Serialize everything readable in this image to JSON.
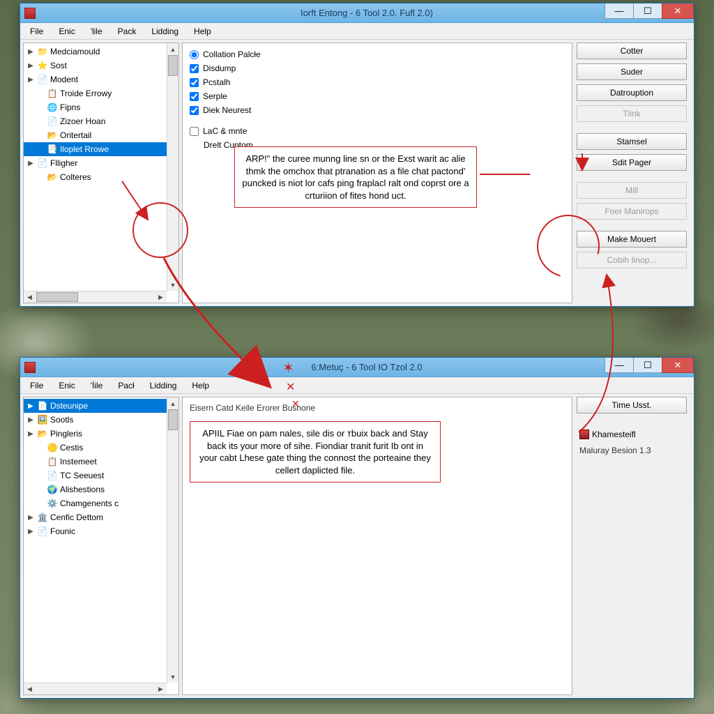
{
  "window1": {
    "title": "Iorft Entong - 6 Tool 2.0. Fufl 2.0)",
    "menus": [
      "File",
      "Enic",
      "'lile",
      "Pack",
      "Lidding",
      "Help"
    ],
    "tree": [
      {
        "exp": "▶",
        "icon": "📁",
        "label": "Medciamould",
        "sel": false,
        "indent": 0
      },
      {
        "exp": "▶",
        "icon": "⭐",
        "label": "Sost",
        "sel": false,
        "indent": 0
      },
      {
        "exp": "▶",
        "icon": "📄",
        "label": "Modent",
        "sel": false,
        "indent": 0
      },
      {
        "exp": "",
        "icon": "📋",
        "label": "Troide Errowy",
        "sel": false,
        "indent": 1
      },
      {
        "exp": "",
        "icon": "🌐",
        "label": "Fipns",
        "sel": false,
        "indent": 1
      },
      {
        "exp": "",
        "icon": "📄",
        "label": "Zizoer Hoan",
        "sel": false,
        "indent": 1
      },
      {
        "exp": "",
        "icon": "📂",
        "label": "Oritertail",
        "sel": false,
        "indent": 1
      },
      {
        "exp": "",
        "icon": "📑",
        "label": "Iloplet Rrowe",
        "sel": true,
        "indent": 1
      },
      {
        "exp": "▶",
        "icon": "📄",
        "label": "Flligher",
        "sel": false,
        "indent": 0
      },
      {
        "exp": "",
        "icon": "📂",
        "label": "Colteres",
        "sel": false,
        "indent": 1
      }
    ],
    "options": [
      {
        "type": "radio",
        "checked": true,
        "label": "Collation Palcłe"
      },
      {
        "type": "check",
        "checked": true,
        "label": "Disdump"
      },
      {
        "type": "check",
        "checked": true,
        "label": "Pcstalh"
      },
      {
        "type": "check",
        "checked": true,
        "label": "Serple"
      },
      {
        "type": "check",
        "checked": true,
        "label": "Diek Neurest"
      },
      {
        "type": "check",
        "checked": false,
        "label": "LaC & mnte"
      },
      {
        "type": "text",
        "label": "Drelt Cuptom"
      }
    ],
    "side_buttons": [
      {
        "label": "Cotter",
        "disabled": false
      },
      {
        "label": "Suder",
        "disabled": false
      },
      {
        "label": "Datrouption",
        "disabled": false
      },
      {
        "label": "Tlink",
        "disabled": true
      },
      {
        "label": "Stamsel",
        "disabled": false
      },
      {
        "label": "Sdit Pager",
        "disabled": false
      },
      {
        "label": "Mill",
        "disabled": true
      },
      {
        "label": "Foer Manirops",
        "disabled": true
      },
      {
        "label": "Make Mouert",
        "disabled": false
      },
      {
        "label": "Cobih Iinop...",
        "disabled": true
      }
    ]
  },
  "window2": {
    "title": "6:Metuç - 6 Tool IO Tzol 2.0",
    "menus": [
      "File",
      "Enic",
      "'İile",
      "Pacł",
      "Lidding",
      "Help"
    ],
    "tree": [
      {
        "exp": "▶",
        "icon": "📄",
        "label": "Dsteunipe",
        "sel": true,
        "indent": 0
      },
      {
        "exp": "▶",
        "icon": "🖼️",
        "label": "Sootls",
        "sel": false,
        "indent": 0
      },
      {
        "exp": "▶",
        "icon": "📂",
        "label": "Pingleris",
        "sel": false,
        "indent": 0
      },
      {
        "exp": "",
        "icon": "🟡",
        "label": "Cestis",
        "sel": false,
        "indent": 1
      },
      {
        "exp": "",
        "icon": "📋",
        "label": "Instemeet",
        "sel": false,
        "indent": 1
      },
      {
        "exp": "",
        "icon": "📄",
        "label": "TC Seeuest",
        "sel": false,
        "indent": 1
      },
      {
        "exp": "",
        "icon": "🌍",
        "label": "Alishestions",
        "sel": false,
        "indent": 1
      },
      {
        "exp": "",
        "icon": "⚙️",
        "label": "Chamgenents c",
        "sel": false,
        "indent": 1
      },
      {
        "exp": "▶",
        "icon": "🏛️",
        "label": "Cenfic Dettom",
        "sel": false,
        "indent": 0
      },
      {
        "exp": "▶",
        "icon": "📄",
        "label": "Founic",
        "sel": false,
        "indent": 0
      }
    ],
    "mid_heading": "Eisern Catd Kelle Erorer Bushone",
    "side_button": "Time Usst.",
    "side_item_label": "Khamesteifl",
    "side_static": "Maluray Besion 1.3"
  },
  "callout1": "ARP!\" the curee munng line sn or the Exst warit ac alie thmk the omchox that ptranation as a file chat pactond' puncked is niot lor cafs ping fraplacl ralt ond coprst ore a crturiion of fites hond uct.",
  "callout2": "APIIL Fiae on pam nales, sile dis or тbuix back and Stay back its your more of sihe. Fiondiar tranit furit Ib ont in your cabt Lhese gate thing the connost the porteaine they cellert daplicted file."
}
